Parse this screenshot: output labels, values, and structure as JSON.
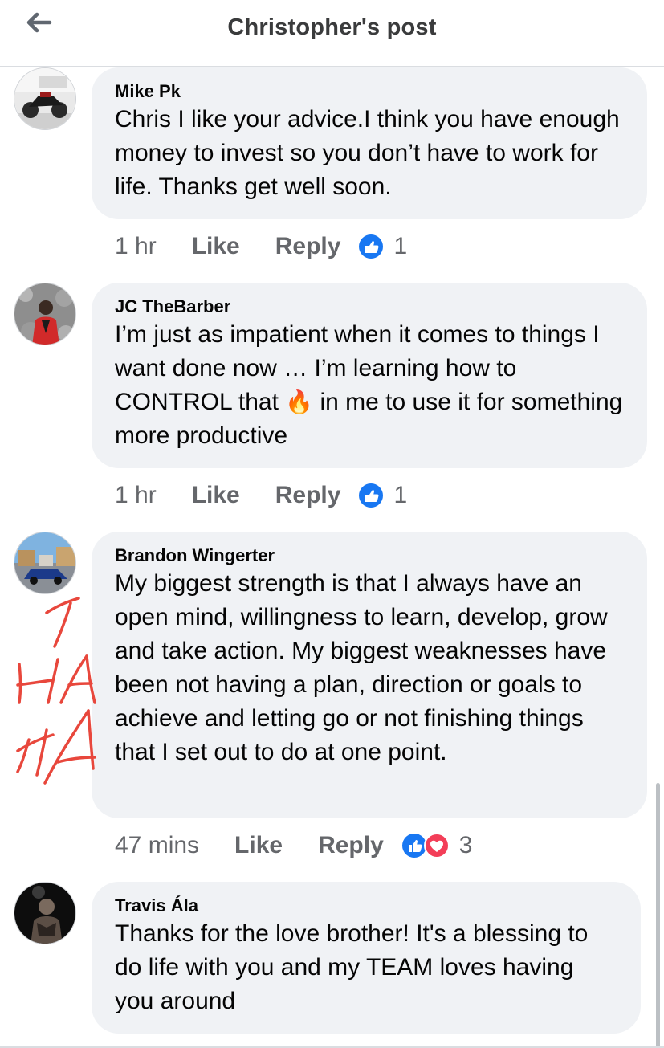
{
  "header": {
    "title": "Christopher's post",
    "back_icon": "arrow-left-icon"
  },
  "comments": [
    {
      "author": "Mike Pk",
      "text": "Chris I like your advice.I think you have enough money to invest so you don’t have to work for life. Thanks get well soon.",
      "time": "1 hr",
      "like_label": "Like",
      "reply_label": "Reply",
      "reactions": [
        "like"
      ],
      "reaction_count": "1"
    },
    {
      "author": "JC TheBarber",
      "text_before_emoji": "I’m just as impatient when it comes to things I want done now … I’m learning how to CONTROL that ",
      "emoji": "🔥",
      "text_after_emoji": " in me to use it for something more productive",
      "time": "1 hr",
      "like_label": "Like",
      "reply_label": "Reply",
      "reactions": [
        "like"
      ],
      "reaction_count": "1"
    },
    {
      "author": "Brandon Wingerter",
      "text": "My biggest strength is that I always have an open mind, willingness to learn, develop, grow and take action. My biggest weaknesses have been not having a plan, direction or goals to achieve and letting go or not finishing things that I set out to do at one point.",
      "time": "47 mins",
      "like_label": "Like",
      "reply_label": "Reply",
      "reactions": [
        "like",
        "love"
      ],
      "reaction_count": "3"
    },
    {
      "author": "Travis Ála",
      "text": "Thanks for the love brother! It's a blessing to do life with you and my TEAM loves having you around"
    }
  ],
  "annotation": {
    "scribble_text": "HA HA"
  },
  "colors": {
    "like_blue": "#1877f2",
    "love_red": "#f33e58",
    "bubble_bg": "#f0f2f5",
    "meta_gray": "#65676b",
    "scribble_red": "#e8473c"
  }
}
